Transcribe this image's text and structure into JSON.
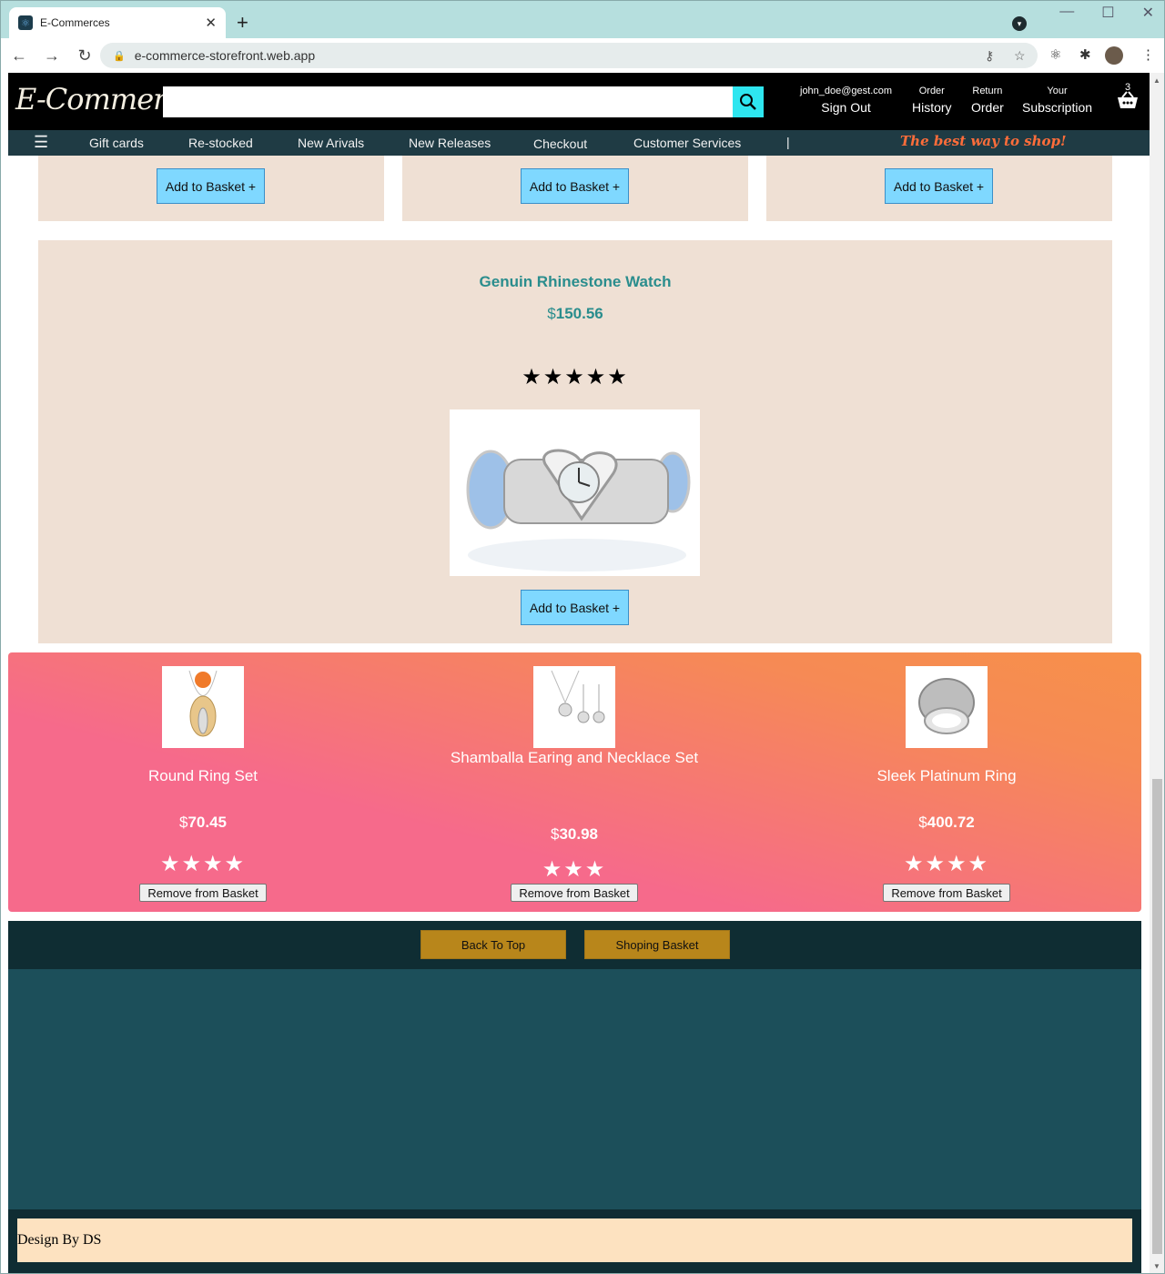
{
  "browser": {
    "tab_title": "E-Commerces",
    "tab_close": "✕",
    "new_tab": "+",
    "url": "e-commerce-storefront.web.app"
  },
  "header": {
    "logo": "E-Commerce",
    "search_placeholder": "",
    "account_small": "john_doe@gest.com",
    "account_big": "Sign Out",
    "orders_small": "Order",
    "orders_big": "History",
    "returns_small": "Return",
    "returns_big": "Order",
    "subscription_small": "Your",
    "subscription_big": "Subscription",
    "basket_count": "3"
  },
  "subnav": {
    "items": [
      "Gift cards",
      "Re-stocked",
      "New Arivals",
      "New Releases",
      "Checkout",
      "Customer Services"
    ],
    "separator": "|",
    "slogan": "The best way to shop!"
  },
  "products": {
    "add_label": "Add to Basket +",
    "featured": {
      "title": "Genuin Rhinestone Watch",
      "currency": "$",
      "price": "150.56",
      "stars": "★★★★★",
      "rating": 5
    }
  },
  "basket": {
    "remove_label": "Remove from Basket",
    "items": [
      {
        "name": "Round Ring Set",
        "currency": "$",
        "price": "70.45",
        "stars": "★★★★",
        "rating": 4
      },
      {
        "name": "Shamballa Earing and Necklace Set",
        "currency": "$",
        "price": "30.98",
        "stars": "★★★",
        "rating": 3
      },
      {
        "name": "Sleek Platinum Ring",
        "currency": "$",
        "price": "400.72",
        "stars": "★★★★",
        "rating": 4
      }
    ]
  },
  "footer": {
    "back_to_top": "Back To Top",
    "shopping_basket": "Shoping Basket",
    "credit": "Design By DS"
  },
  "colors": {
    "accent_teal": "#2a8d8d",
    "card_bg": "#efe0d4",
    "button_blue": "#7fd8ff",
    "slogan_orange": "#ff6d3a",
    "footer_gold": "#b8861b"
  }
}
